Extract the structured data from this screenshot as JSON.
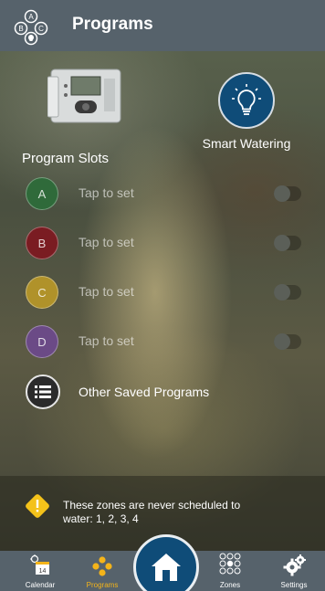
{
  "header": {
    "title": "Programs"
  },
  "controller": {
    "label_a": "A",
    "label_b": "B",
    "label_c": "C"
  },
  "smart": {
    "label": "Smart Watering"
  },
  "slots_label": "Program Slots",
  "slots": [
    {
      "letter": "A",
      "text": "Tap to set",
      "color": "#2f6a3a",
      "enabled": false
    },
    {
      "letter": "B",
      "text": "Tap to set",
      "color": "#7a1c22",
      "enabled": false
    },
    {
      "letter": "C",
      "text": "Tap to set",
      "color": "#b0922a",
      "enabled": false
    },
    {
      "letter": "D",
      "text": "Tap to set",
      "color": "#6b4a86",
      "enabled": false
    }
  ],
  "other": {
    "label": "Other Saved Programs"
  },
  "warning": {
    "text": "These zones are never scheduled to water: 1, 2, 3, 4"
  },
  "nav": {
    "calendar": {
      "label": "Calendar",
      "day": "14"
    },
    "programs": {
      "label": "Programs"
    },
    "zones": {
      "label": "Zones"
    },
    "settings": {
      "label": "Settings"
    }
  },
  "colors": {
    "topbar": "#56626b",
    "accent": "#f4b41a",
    "primary": "#0f4c78"
  }
}
